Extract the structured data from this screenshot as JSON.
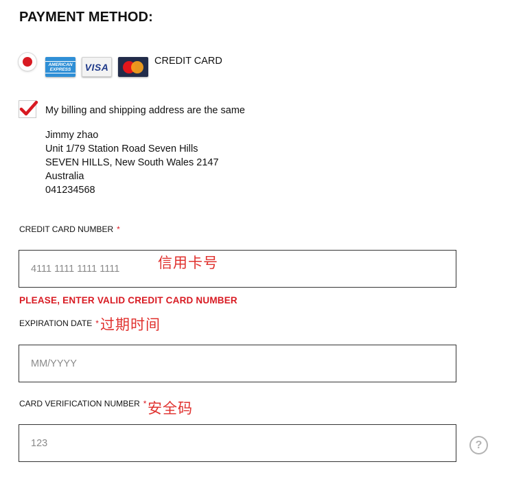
{
  "section": {
    "title": "PAYMENT METHOD:"
  },
  "payment_option": {
    "label": "CREDIT CARD",
    "selected": true,
    "cards": [
      {
        "icon": "amex-card-icon",
        "text": "AMERICAN EXPRESS"
      },
      {
        "icon": "visa-card-icon",
        "text": "VISA"
      },
      {
        "icon": "mastercard-card-icon",
        "text": ""
      }
    ]
  },
  "billing": {
    "same_label": "My billing and shipping address are the same",
    "checked": true,
    "address_lines": [
      "Jimmy zhao",
      "Unit 1/79 Station Road Seven Hills",
      "SEVEN HILLS, New South Wales 2147",
      "Australia",
      "041234568"
    ]
  },
  "card_number": {
    "label": "CREDIT CARD NUMBER",
    "required_mark": "*",
    "placeholder": "4111 1111 1111 1111",
    "annotation": "信用卡号",
    "error": "PLEASE, ENTER VALID CREDIT CARD NUMBER"
  },
  "expiration": {
    "label": "EXPIRATION DATE",
    "required_mark": "*",
    "placeholder": "MM/YYYY",
    "annotation": "过期时间"
  },
  "cvv": {
    "label": "CARD VERIFICATION NUMBER",
    "required_mark": "*",
    "placeholder": "123",
    "annotation": "安全码",
    "help_symbol": "?"
  },
  "colors": {
    "accent_red": "#d81a22",
    "annotation_red": "#e0302d",
    "border": "#333333"
  }
}
